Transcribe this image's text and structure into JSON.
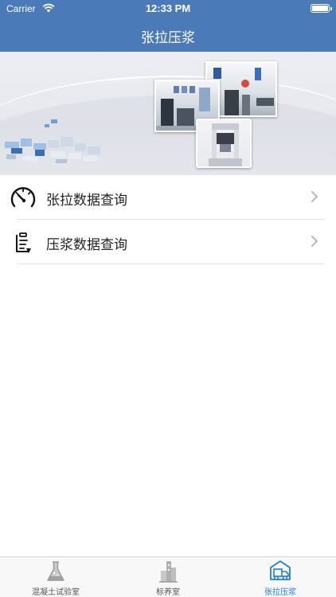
{
  "status_bar": {
    "carrier": "Carrier",
    "time": "12:33 PM"
  },
  "nav": {
    "title": "张拉压浆"
  },
  "banner": {
    "image": "laboratory-equipment-banner"
  },
  "menu": {
    "items": [
      {
        "label": "张拉数据查询",
        "icon": "gauge-icon"
      },
      {
        "label": "压浆数据查询",
        "icon": "clipboard-icon"
      }
    ]
  },
  "tabbar": {
    "tabs": [
      {
        "label": "混凝土试验室",
        "icon": "flask-icon",
        "active": false
      },
      {
        "label": "标养室",
        "icon": "building-icon",
        "active": false
      },
      {
        "label": "张拉压浆",
        "icon": "truck-icon",
        "active": true
      }
    ]
  },
  "colors": {
    "nav_bar": "#4a7ab8",
    "tab_active": "#1f7de0",
    "tab_inactive": "#555555"
  }
}
